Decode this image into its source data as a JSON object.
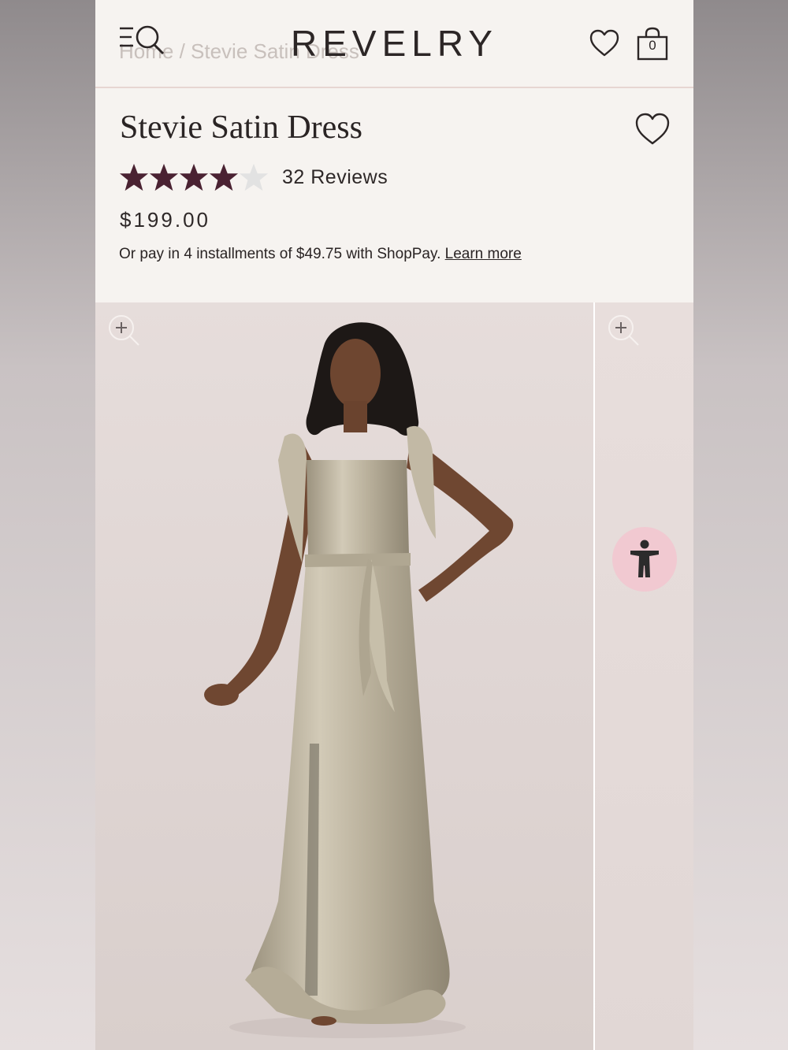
{
  "header": {
    "breadcrumb": "Home / Stevie Satin Dress",
    "logo": "REVELRY",
    "cart_count": "0"
  },
  "product": {
    "title": "Stevie Satin Dress",
    "rating": 4,
    "rating_max": 5,
    "reviews_label": "32 Reviews",
    "price": "$199.00",
    "installments_text": "Or pay in 4 installments of $49.75 with ShopPay.",
    "learn_more": "Learn more"
  },
  "colors": {
    "star_filled": "#4a2232",
    "star_empty": "#e2e2e2",
    "accessibility_bg": "#f1c9d1",
    "dress": "#bfb6a2"
  },
  "icons": [
    "menu-icon",
    "search-icon",
    "heart-icon",
    "bag-icon",
    "zoom-in-icon",
    "accessibility-icon"
  ]
}
